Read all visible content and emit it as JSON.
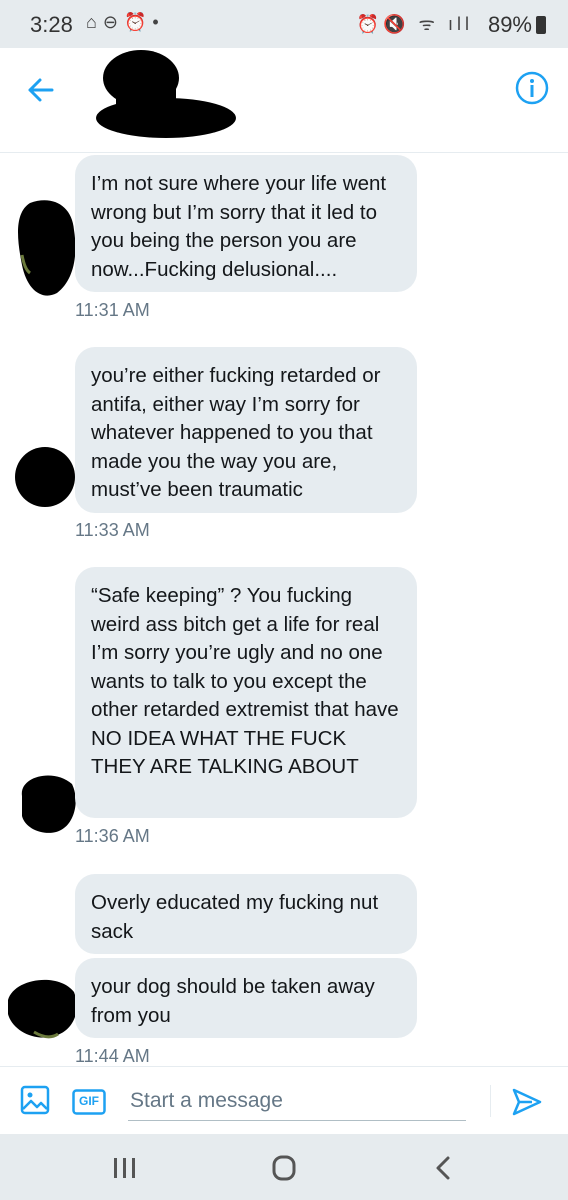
{
  "status_bar": {
    "time": "3:28",
    "battery": "89%"
  },
  "messages": [
    {
      "text": "I’m not sure where your life went wrong but I’m sorry that it led to you being the person you are now...Fucking delusional...."
    },
    {
      "time": "11:31 AM"
    },
    {
      "text": "you’re either fucking retarded or antifa, either way I’m sorry for whatever happened to you that made you the way you are, must’ve been traumatic"
    },
    {
      "time": "11:33 AM"
    },
    {
      "text": "“Safe keeping” ? You fucking weird ass bitch get a life for real I’m sorry you’re ugly and no one wants to talk to you except the other retarded extremist that have NO IDEA WHAT THE FUCK THEY ARE TALKING ABOUT"
    },
    {
      "time": "11:36 AM"
    },
    {
      "text": "Overly educated my fucking nut sack"
    },
    {
      "text": "your dog should be taken away from you"
    },
    {
      "time": "11:44 AM"
    }
  ],
  "composer": {
    "placeholder": "Start a message",
    "gif_label": "GIF"
  },
  "colors": {
    "accent": "#1da1f2",
    "bubble": "#e6ecf0",
    "system_bar": "#e6ebee"
  }
}
